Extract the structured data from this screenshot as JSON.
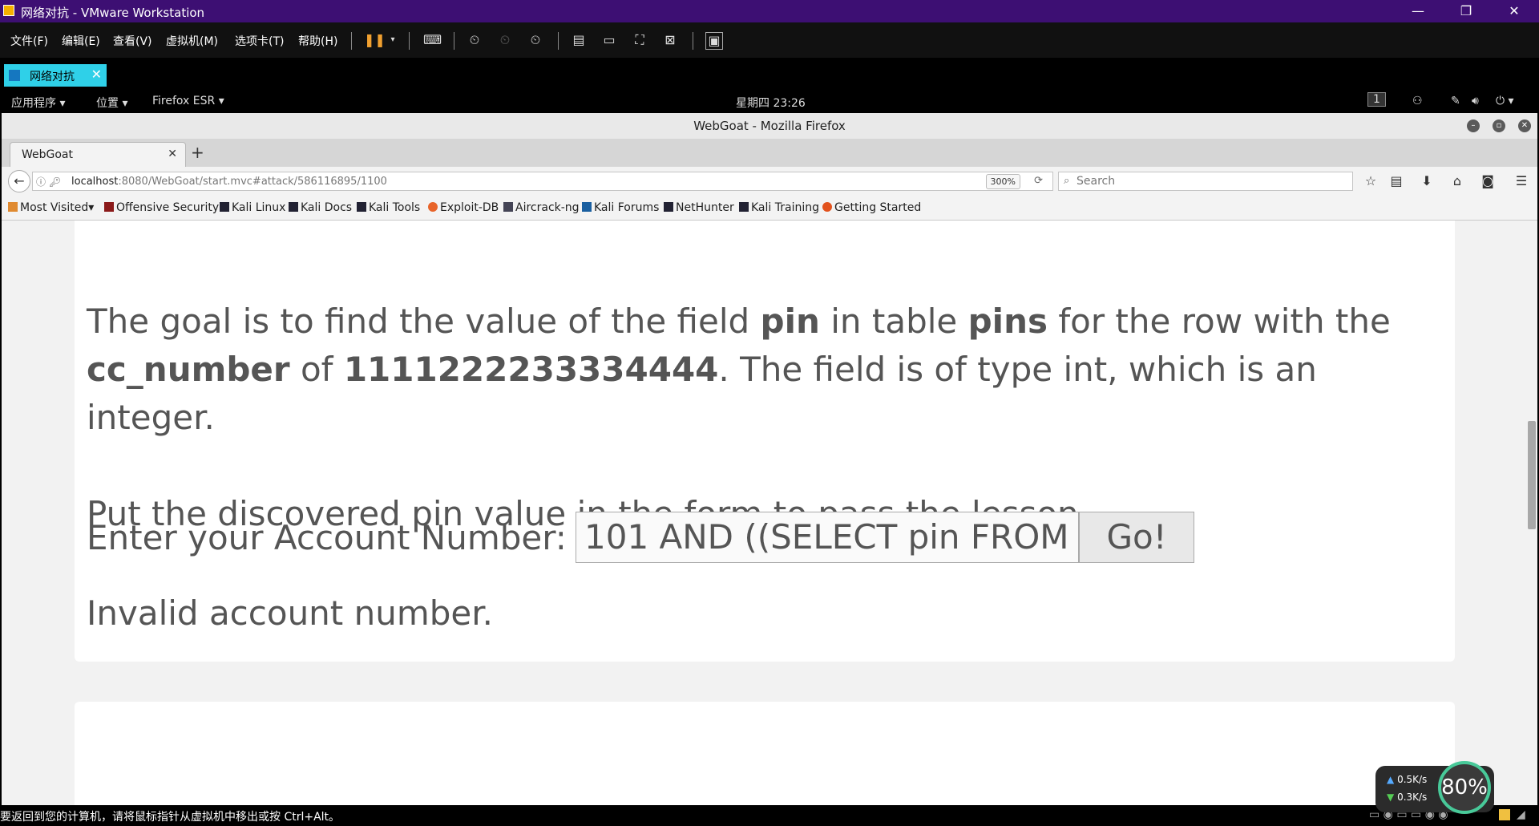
{
  "vm": {
    "title": "网络对抗 - VMware Workstation",
    "menu": [
      "文件(F)",
      "编辑(E)",
      "查看(V)",
      "虚拟机(M)",
      "选项卡(T)",
      "帮助(H)"
    ],
    "tab_label": "网络对抗",
    "status_text": "要返回到您的计算机，请将鼠标指针从虚拟机中移出或按 Ctrl+Alt。"
  },
  "gnome": {
    "apps": "应用程序 ▾",
    "places": "位置 ▾",
    "firefox": "Firefox ESR ▾",
    "clock": "星期四 23:26",
    "workspace": "1"
  },
  "firefox": {
    "window_title": "WebGoat - Mozilla Firefox",
    "tab_title": "WebGoat",
    "url_host": "localhost",
    "url_path": ":8080/WebGoat/start.mvc#attack/586116895/1100",
    "zoom": "300%",
    "search_placeholder": "Search",
    "bookmarks": [
      "Most Visited",
      "Offensive Security",
      "Kali Linux",
      "Kali Docs",
      "Kali Tools",
      "Exploit-DB",
      "Aircrack-ng",
      "Kali Forums",
      "NetHunter",
      "Kali Training",
      "Getting Started"
    ]
  },
  "lesson": {
    "line1_a": "The goal is to find the value of the field ",
    "line1_b": "pin",
    "line1_c": " in table ",
    "line1_d": "pins",
    "line1_e": " for the row with the",
    "line2_a": "cc_number",
    "line2_b": " of ",
    "line2_c": "1111222233334444",
    "line2_d": ". The field is of type int, which is an",
    "line3": "integer.",
    "line4": "Put the discovered pin value in the form to pass the lesson.",
    "account_label": "Enter your Account Number:",
    "account_value": "101 AND ((SELECT pin FROM",
    "go_label": "Go!",
    "result": "Invalid account number."
  },
  "net_widget": {
    "up": "0.5K/s",
    "down": "0.3K/s",
    "percent": "80%"
  }
}
